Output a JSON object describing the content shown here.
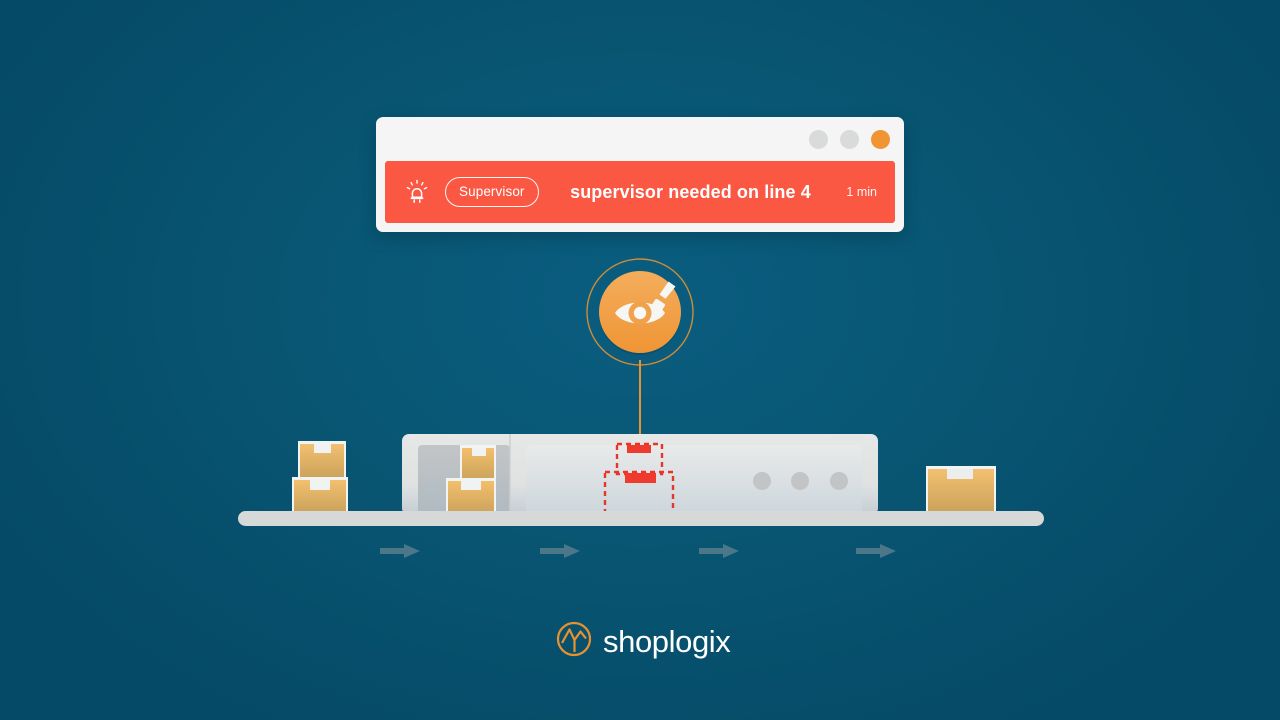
{
  "theme": {
    "background_dark": "#064f6d",
    "background_light": "#0a5d80",
    "alert_red": "#fb5844",
    "accent_orange": "#f09434",
    "logo_orange": "#e8922f",
    "belt_grey": "#d7d8d8",
    "box_amber": "#edb95f",
    "arrow_grey": "#4b7789"
  },
  "alert_window": {
    "titlebar": {
      "dots": [
        {
          "name": "window-dot-minimize",
          "color": "#d9dada"
        },
        {
          "name": "window-dot-maximize",
          "color": "#d9dada"
        },
        {
          "name": "window-dot-close",
          "color": "#f09434"
        }
      ]
    },
    "notification": {
      "icon": "siren-alarm-icon",
      "chip_label": "Supervisor",
      "message": "supervisor needed on line 4",
      "time": "1 min",
      "background": "#fb5844"
    }
  },
  "inspector": {
    "icon": "magnifier-eye-icon",
    "badge_color": "#f2a24a",
    "ring_color": "#d9912f"
  },
  "production_line": {
    "belt_label": "conveyor-belt",
    "flow_arrows": 4,
    "boxes_before": 2,
    "boxes_in_machine": 2,
    "boxes_after": 1,
    "scan_zone": {
      "label": "scan-highlight-region",
      "outline_color": "#e8352a",
      "outline_style": "dashed",
      "flagged_boxes": 2
    },
    "machine_indicators": 3
  },
  "logo": {
    "mark": "shoplogix-mark-icon",
    "text": "shoplogix"
  }
}
